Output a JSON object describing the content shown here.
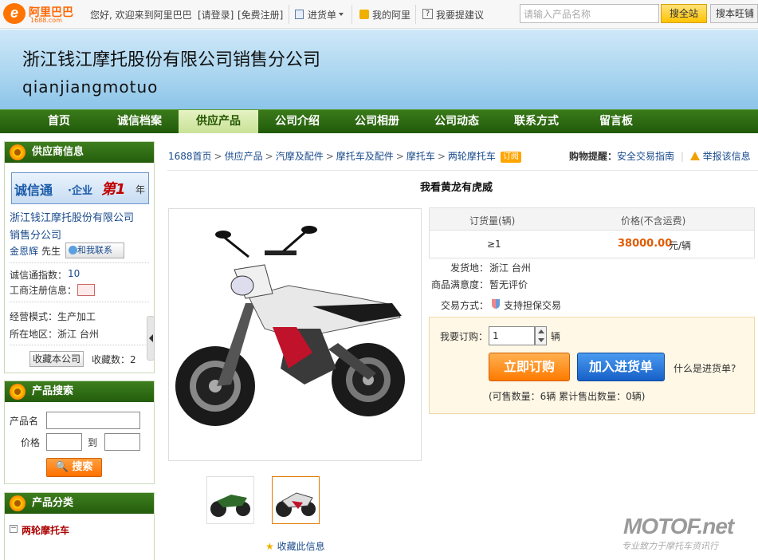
{
  "topbar": {
    "logo_text": "阿里巴巴",
    "logo_sub": "1688.com",
    "welcome": "您好, 欢迎来到阿里巴巴",
    "login": "[请登录]",
    "register": "[免费注册]",
    "cart_menu": "进货单",
    "my_ali": "我的阿里",
    "suggest": "我要提建议",
    "search_placeholder": "请输入产品名称",
    "search_site": "搜全站",
    "search_ww": "搜本旺铺"
  },
  "banner": {
    "company": "浙江钱江摩托股份有限公司销售分公司",
    "pinyin": "qianjiangmotuo"
  },
  "nav": [
    {
      "label": "首页"
    },
    {
      "label": "诚信档案"
    },
    {
      "label": "供应产品"
    },
    {
      "label": "公司介绍"
    },
    {
      "label": "公司相册"
    },
    {
      "label": "公司动态"
    },
    {
      "label": "联系方式"
    },
    {
      "label": "留言板"
    }
  ],
  "supplier": {
    "header": "供应商信息",
    "cxt_a": "诚信通",
    "cxt_b": "·企业",
    "cxt_c": "第1",
    "cxt_d": "年",
    "company_line1": "浙江钱江摩托股份有限公司",
    "company_line2": "销售分公司",
    "contact_name": "金恩辉",
    "contact_title": "先生",
    "contact_btn": "和我联系",
    "index_label": "诚信通指数：",
    "index_value": "10",
    "reg_label": "工商注册信息：",
    "mode": "经营模式：生产加工",
    "region": "所在地区：浙江 台州",
    "collect_btn": "收藏本公司",
    "collect_count": "收藏数：2"
  },
  "search": {
    "header": "产品搜索",
    "name_label": "产品名",
    "price_label": "价格",
    "to": "到",
    "button": "搜索"
  },
  "category": {
    "header": "产品分类",
    "item": "两轮摩托车"
  },
  "breadcrumb": {
    "items": [
      "1688首页",
      "供应产品",
      "汽摩及配件",
      "摩托车及配件",
      "摩托车",
      "两轮摩托车"
    ],
    "tag": "订阅",
    "remind_label": "购物提醒：",
    "remind_link": "安全交易指南",
    "report": "举报该信息"
  },
  "product": {
    "title": "我看黄龙有虎威",
    "col_qty": "订货量(辆)",
    "col_price": "价格(不含运费)",
    "qty": "≥1",
    "price": "38000.00",
    "unit": "元/辆",
    "ship_label": "发货地：",
    "ship_value": "浙江 台州",
    "sat_label": "商品满意度：",
    "sat_value": "暂无评价",
    "trade_label": "交易方式：",
    "trade_value": "支持担保交易",
    "order_label": "我要订购：",
    "order_qty": "1",
    "order_unit": "辆",
    "buy_now": "立即订购",
    "add_cart": "加入进货单",
    "what_cart": "什么是进货单?",
    "stock": "(可售数量：6辆   累计售出数量：0辆)",
    "fav": "收藏此信息"
  },
  "watermark": {
    "brand": "MOTOF.net",
    "slogan": "专业致力于摩托车资讯行"
  },
  "colors": {
    "nav_green": "#245d0c",
    "price_orange": "#e05a00",
    "buy_orange": "#ff7a00",
    "cart_blue": "#1760c8"
  }
}
